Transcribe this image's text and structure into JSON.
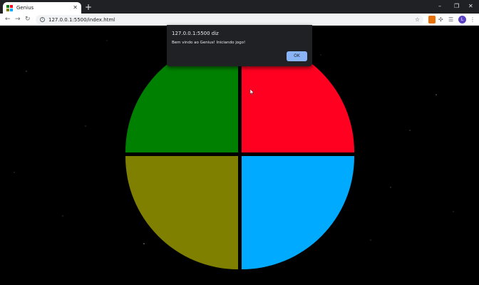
{
  "browser": {
    "tab": {
      "title": "Genius",
      "close_glyph": "✕"
    },
    "new_tab_glyph": "+",
    "window_controls": {
      "minimize": "–",
      "restore": "❐",
      "close": "✕"
    },
    "nav": {
      "back": "←",
      "forward": "→",
      "reload": "↻"
    },
    "address": {
      "info_glyph": "i",
      "url": "127.0.0.1:5500/index.html"
    },
    "star_glyph": "☆",
    "extensions": [
      "extension-icon",
      "puzzle-icon",
      "reading-list-icon"
    ],
    "avatar_initial": "L",
    "menu_glyph": "⋮"
  },
  "game": {
    "colors": {
      "green": "#008000",
      "red": "#ff0020",
      "yellow": "#808000",
      "blue": "#00aaff",
      "background": "#000000"
    }
  },
  "dialog": {
    "title": "127.0.0.1:5500 diz",
    "message": "Bem vindo ao Genius! Iniciando jogo!",
    "ok_label": "OK"
  }
}
